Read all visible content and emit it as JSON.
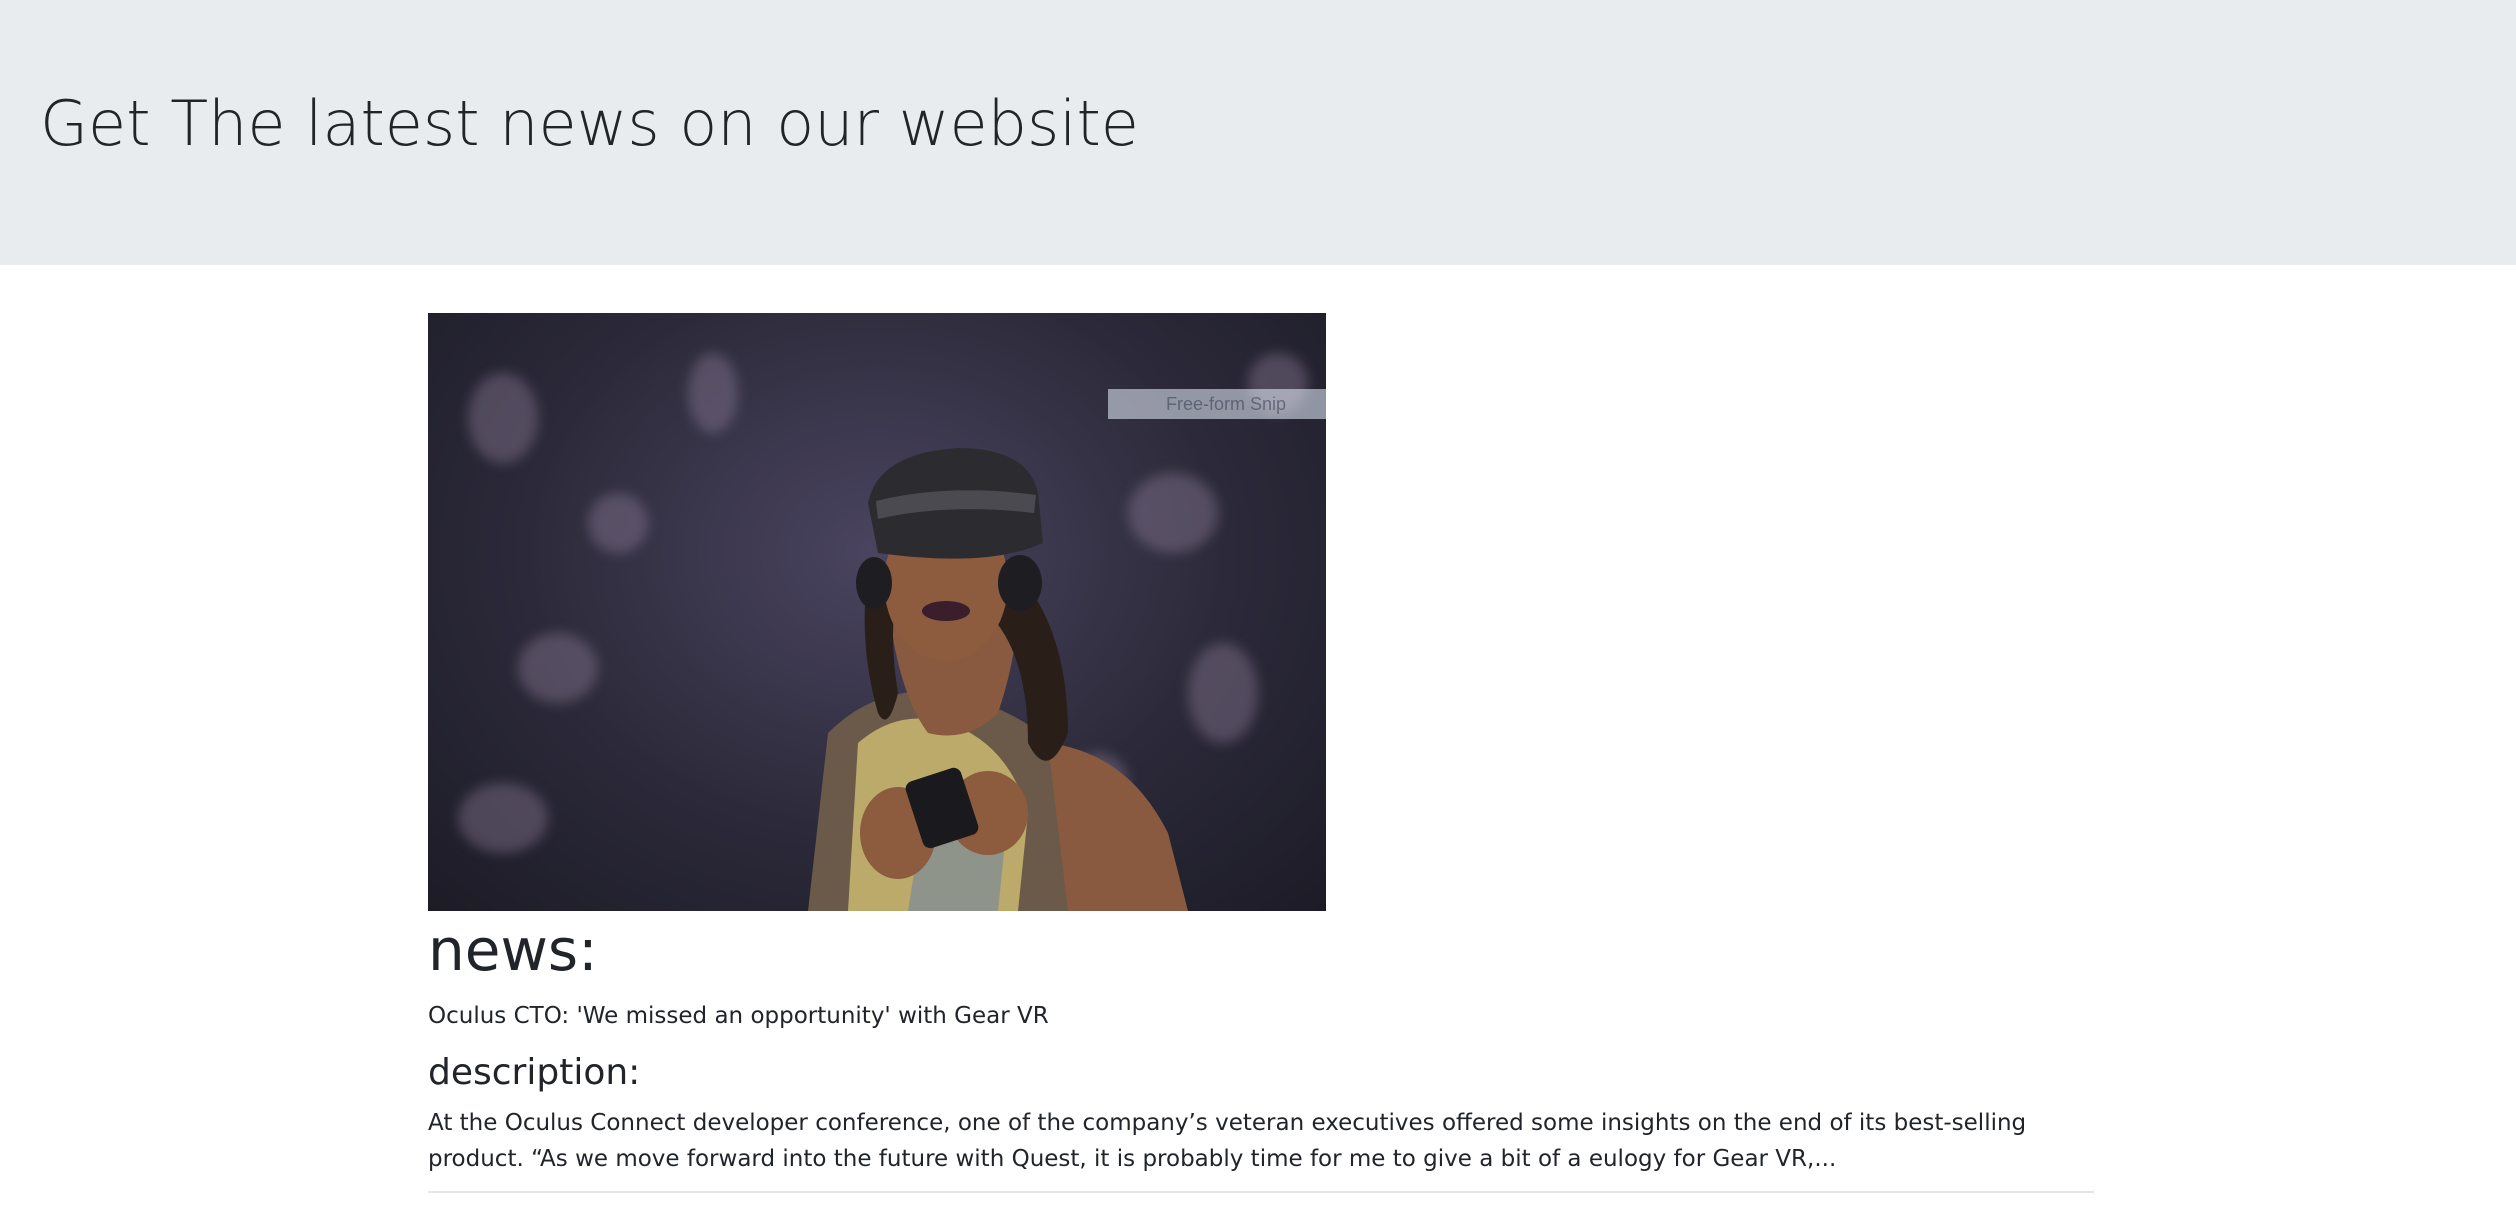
{
  "header": {
    "title": "Get The latest news on our website"
  },
  "article": {
    "image_alt": "Woman wearing a Gear VR headset",
    "snip_overlay_label": "Free-form Snip",
    "news_heading": "news:",
    "news_title": "Oculus CTO: 'We missed an opportunity' with Gear VR",
    "description_heading": "description:",
    "description_text": "At the Oculus Connect developer conference, one of the company’s veteran executives offered some insights on the end of its best-selling product. “As we move forward into the future with Quest, it is probably time for me to give a bit of a eulogy for Gear VR,..."
  },
  "colors": {
    "header_background": "#e9ecef",
    "text": "#212529",
    "divider": "#e6e6e6"
  }
}
